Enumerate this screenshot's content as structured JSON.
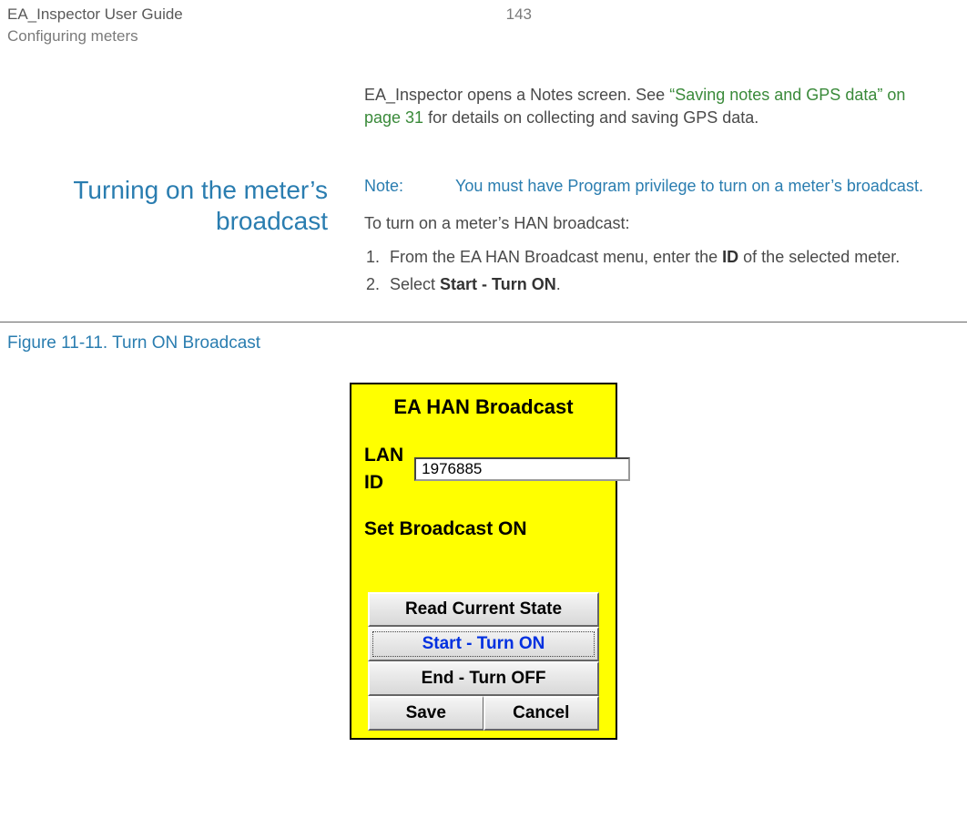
{
  "header": {
    "title": "EA_Inspector User Guide",
    "subtitle": "Configuring meters",
    "page_number": "143"
  },
  "intro_paragraph": {
    "prefix": "EA_Inspector opens a Notes screen. See ",
    "link": "“Saving notes and GPS data” on page 31",
    "suffix": " for details on collecting and saving GPS data."
  },
  "section": {
    "heading": "Turning on the meter’s broadcast",
    "note_label": "Note:",
    "note_text": "You must have Program privilege to turn on a meter’s broadcast.",
    "intro": "To turn on a meter’s HAN broadcast:",
    "steps": [
      {
        "pre": "From the EA HAN Broadcast menu, enter the ",
        "bold": "ID",
        "post": " of the selected meter."
      },
      {
        "pre": "Select ",
        "bold": "Start - Turn ON",
        "post": "."
      }
    ]
  },
  "figure": {
    "caption": "Figure 11-11. Turn ON Broadcast"
  },
  "device": {
    "title": "EA HAN Broadcast",
    "lan_label": "LAN ID",
    "lan_value": "1976885",
    "status": "Set Broadcast ON",
    "buttons": {
      "read": "Read Current State",
      "start": "Start - Turn ON",
      "end": "End - Turn OFF",
      "save": "Save",
      "cancel": "Cancel"
    }
  }
}
